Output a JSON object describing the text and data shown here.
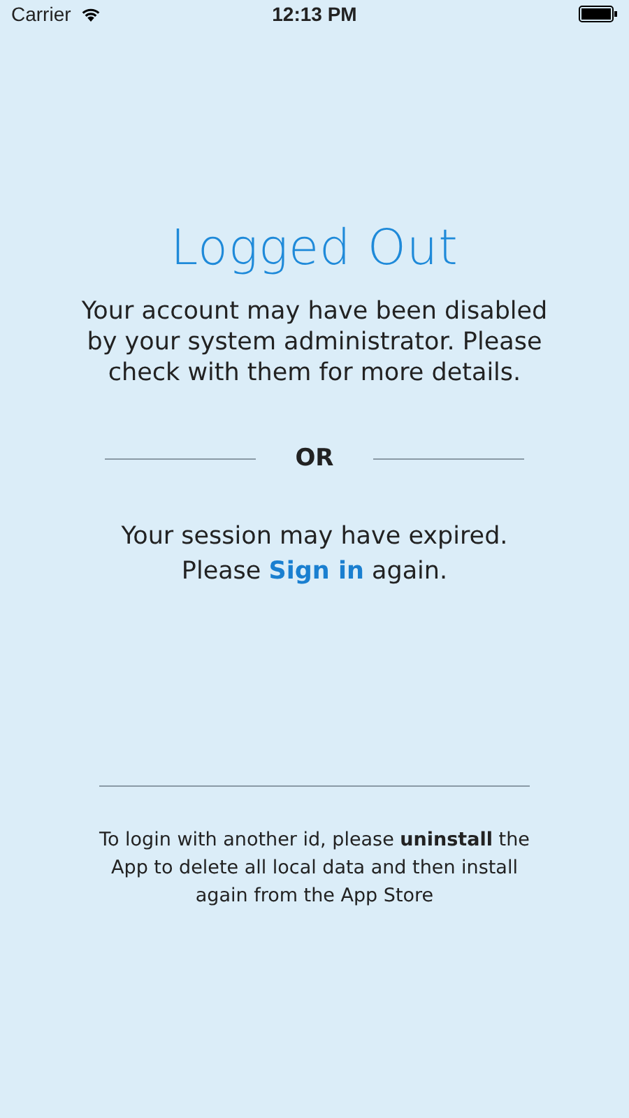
{
  "status_bar": {
    "carrier": "Carrier",
    "time": "12:13 PM"
  },
  "title": "Logged Out",
  "disabled_message": "Your account may have been disabled by your system administrator. Please check with them for more details.",
  "separator_label": "OR",
  "session": {
    "first_line": "Your session may have expired.",
    "before_link": "Please",
    "link": "Sign in",
    "after_link": "again."
  },
  "footer_note": "To login with another id, please **uninstall** the App to delete all local data and then install again from the App Store"
}
